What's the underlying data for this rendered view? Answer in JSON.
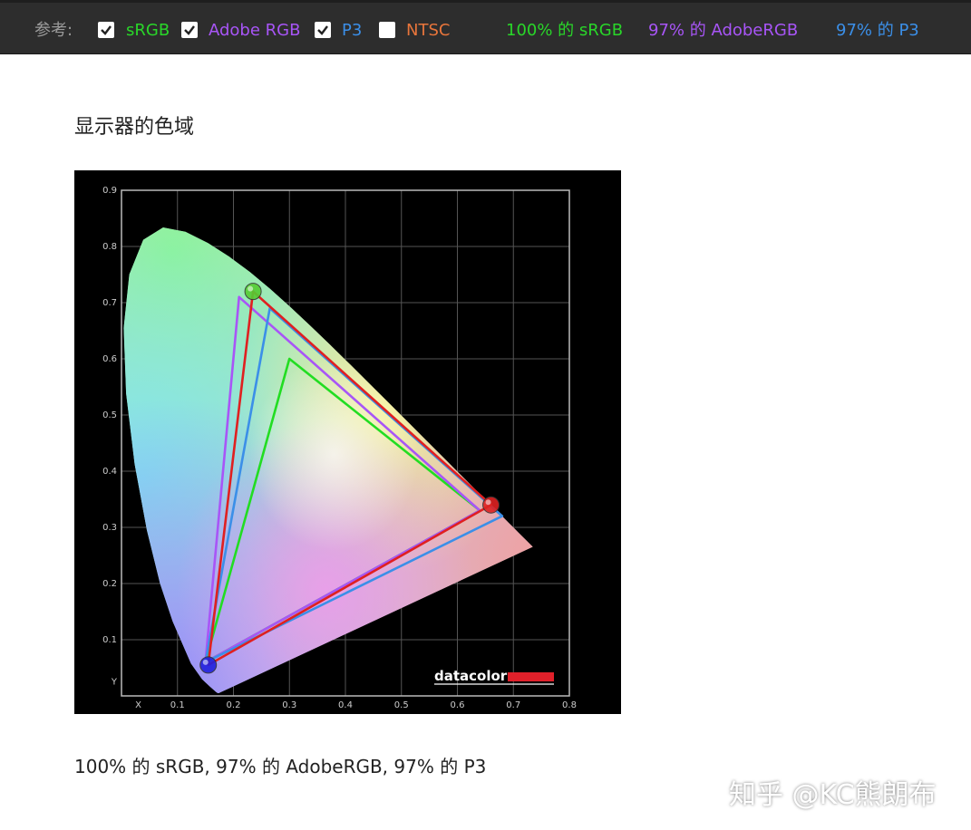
{
  "toolbar": {
    "ref_label": "参考:",
    "checkboxes": [
      {
        "label": "sRGB",
        "checked": true,
        "color": "#29d629"
      },
      {
        "label": "Adobe RGB",
        "checked": true,
        "color": "#a855f7"
      },
      {
        "label": "P3",
        "checked": true,
        "color": "#3b8fe8"
      },
      {
        "label": "NTSC",
        "checked": false,
        "color": "#e8753b"
      }
    ],
    "stats": [
      {
        "text": "100% 的 sRGB",
        "color": "#29d629"
      },
      {
        "text": "97% 的 AdobeRGB",
        "color": "#a855f7"
      },
      {
        "text": "97% 的 P3",
        "color": "#3b8fe8"
      }
    ]
  },
  "page": {
    "title": "显示器的色域",
    "caption": "100% 的 sRGB, 97% 的 AdobeRGB, 97% 的 P3",
    "watermark": "知乎 @KC熊朗布"
  },
  "chart_data": {
    "type": "scatter",
    "xlim": [
      0,
      0.8
    ],
    "ylim": [
      0,
      0.9
    ],
    "x_ticks": [
      "X",
      "0.1",
      "0.2",
      "0.3",
      "0.4",
      "0.5",
      "0.6",
      "0.7",
      "0.8"
    ],
    "y_ticks": [
      "Y",
      "0.1",
      "0.2",
      "0.3",
      "0.4",
      "0.5",
      "0.6",
      "0.7",
      "0.8",
      "0.9"
    ],
    "grid": true,
    "brand": "datacolor",
    "series": [
      {
        "name": "sRGB",
        "color": "#22dd22",
        "points": [
          [
            0.64,
            0.33
          ],
          [
            0.3,
            0.6
          ],
          [
            0.15,
            0.06
          ]
        ]
      },
      {
        "name": "Adobe RGB",
        "color": "#a855f7",
        "points": [
          [
            0.64,
            0.33
          ],
          [
            0.21,
            0.71
          ],
          [
            0.15,
            0.06
          ]
        ]
      },
      {
        "name": "P3",
        "color": "#3b8fe8",
        "points": [
          [
            0.68,
            0.32
          ],
          [
            0.265,
            0.69
          ],
          [
            0.15,
            0.06
          ]
        ]
      },
      {
        "color": "#e02020",
        "points": [
          [
            0.66,
            0.34
          ],
          [
            0.235,
            0.72
          ],
          [
            0.155,
            0.055
          ]
        ]
      }
    ],
    "markers": [
      {
        "color": "#dd2222",
        "point": [
          0.66,
          0.34
        ]
      },
      {
        "color": "#55cc33",
        "point": [
          0.235,
          0.72
        ]
      },
      {
        "color": "#2222dd",
        "point": [
          0.155,
          0.055
        ]
      }
    ]
  }
}
